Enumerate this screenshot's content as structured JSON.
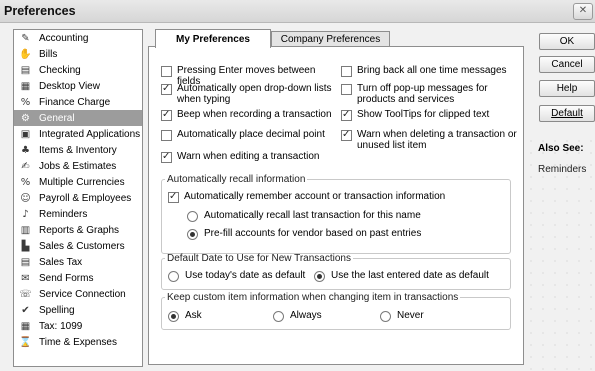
{
  "window": {
    "title": "Preferences",
    "close_glyph": "✕"
  },
  "sidebar": {
    "items": [
      {
        "label": "Accounting",
        "icon": "accounting-icon",
        "glyph": "✎"
      },
      {
        "label": "Bills",
        "icon": "bills-icon",
        "glyph": "✋"
      },
      {
        "label": "Checking",
        "icon": "checking-icon",
        "glyph": "▤"
      },
      {
        "label": "Desktop View",
        "icon": "desktop-view-icon",
        "glyph": "▦"
      },
      {
        "label": "Finance Charge",
        "icon": "finance-charge-icon",
        "glyph": "%"
      },
      {
        "label": "General",
        "icon": "general-icon",
        "glyph": "⚙"
      },
      {
        "label": "Integrated Applications",
        "icon": "integrated-applications-icon",
        "glyph": "▣"
      },
      {
        "label": "Items & Inventory",
        "icon": "items-inventory-icon",
        "glyph": "♣"
      },
      {
        "label": "Jobs & Estimates",
        "icon": "jobs-estimates-icon",
        "glyph": "✍"
      },
      {
        "label": "Multiple Currencies",
        "icon": "multiple-currencies-icon",
        "glyph": "%"
      },
      {
        "label": "Payroll & Employees",
        "icon": "payroll-employees-icon",
        "glyph": "☺"
      },
      {
        "label": "Reminders",
        "icon": "reminders-icon",
        "glyph": "♪"
      },
      {
        "label": "Reports & Graphs",
        "icon": "reports-graphs-icon",
        "glyph": "▥"
      },
      {
        "label": "Sales & Customers",
        "icon": "sales-customers-icon",
        "glyph": "▙"
      },
      {
        "label": "Sales Tax",
        "icon": "sales-tax-icon",
        "glyph": "▤"
      },
      {
        "label": "Send Forms",
        "icon": "send-forms-icon",
        "glyph": "✉"
      },
      {
        "label": "Service Connection",
        "icon": "service-connection-icon",
        "glyph": "☏"
      },
      {
        "label": "Spelling",
        "icon": "spelling-icon",
        "glyph": "✔"
      },
      {
        "label": "Tax: 1099",
        "icon": "tax-1099-icon",
        "glyph": "▦"
      },
      {
        "label": "Time & Expenses",
        "icon": "time-expenses-icon",
        "glyph": "⌛"
      }
    ],
    "selected": "General"
  },
  "tabs": {
    "my": "My Preferences",
    "company": "Company Preferences"
  },
  "options": {
    "pressing_enter": {
      "label": "Pressing Enter moves between fields",
      "checked": false
    },
    "auto_dropdown": {
      "label": "Automatically open drop-down lists when typing",
      "checked": true
    },
    "beep": {
      "label": "Beep when recording a transaction",
      "checked": true
    },
    "decimal": {
      "label": "Automatically place decimal point",
      "checked": false
    },
    "warn_editing": {
      "label": "Warn when editing a transaction",
      "checked": true
    },
    "bring_back": {
      "label": "Bring back all one time messages",
      "checked": false
    },
    "popup_off": {
      "label": "Turn off pop-up messages for products and services",
      "checked": false
    },
    "tooltips": {
      "label": "Show ToolTips for clipped text",
      "checked": true
    },
    "warn_deleting": {
      "label": "Warn when deleting a transaction or unused list item",
      "checked": true
    }
  },
  "recall": {
    "legend": "Automatically recall information",
    "remember": {
      "label": "Automatically remember account or transaction information",
      "checked": true
    },
    "last_txn": {
      "label": "Automatically recall last transaction for this name",
      "selected": false
    },
    "prefill": {
      "label": "Pre-fill accounts for vendor based on past entries",
      "selected": true
    }
  },
  "default_date": {
    "legend": "Default Date to Use for New Transactions",
    "today": {
      "label": "Use today's date as default",
      "selected": false
    },
    "last": {
      "label": "Use the last entered date as default",
      "selected": true
    }
  },
  "custom_item": {
    "legend": "Keep custom item information when changing item in transactions",
    "ask": {
      "label": "Ask",
      "selected": true
    },
    "always": {
      "label": "Always",
      "selected": false
    },
    "never": {
      "label": "Never",
      "selected": false
    }
  },
  "buttons": {
    "ok": "OK",
    "cancel": "Cancel",
    "help": "Help",
    "default": "Default"
  },
  "also_see": {
    "title": "Also See:",
    "links": [
      "Reminders"
    ]
  }
}
